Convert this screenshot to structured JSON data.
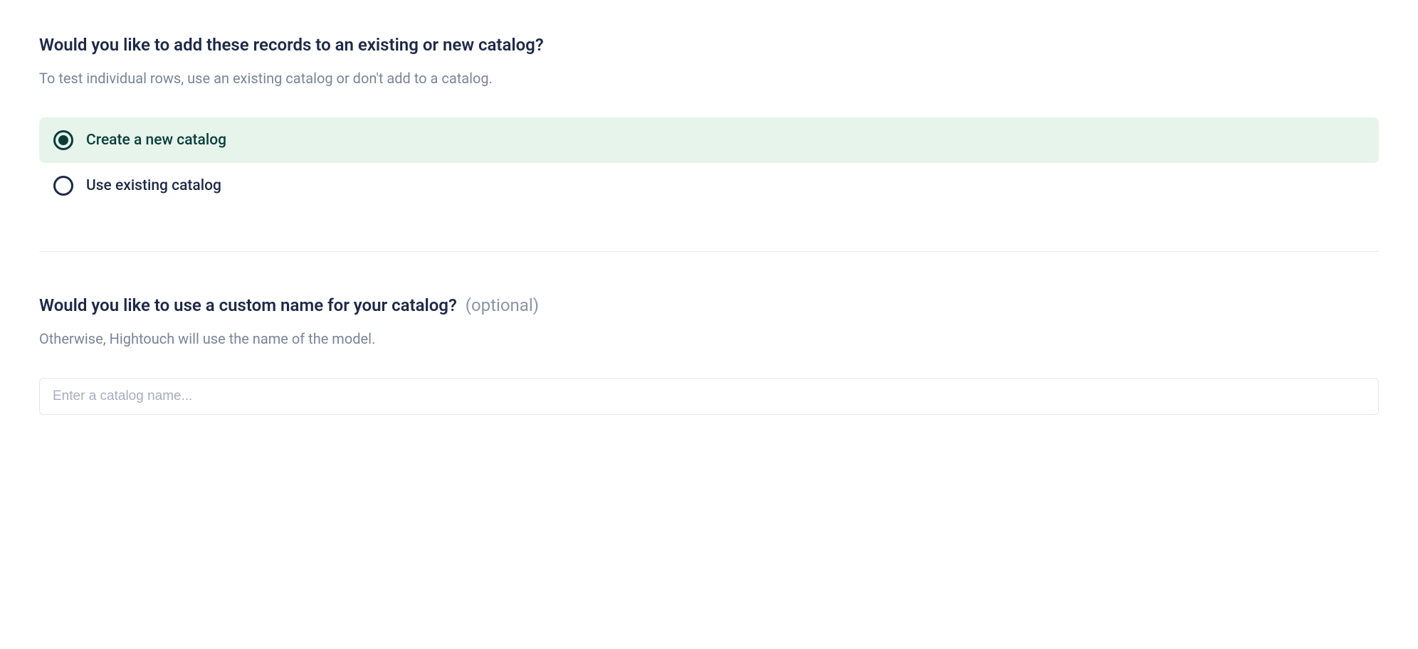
{
  "section1": {
    "title": "Would you like to add these records to an existing or new catalog?",
    "subtitle": "To test individual rows, use an existing catalog or don't add to a catalog.",
    "options": {
      "create": "Create a new catalog",
      "existing": "Use existing catalog"
    }
  },
  "section2": {
    "title": "Would you like to use a custom name for your catalog?",
    "optional": "(optional)",
    "subtitle": "Otherwise, Hightouch will use the name of the model.",
    "input_placeholder": "Enter a catalog name..."
  }
}
